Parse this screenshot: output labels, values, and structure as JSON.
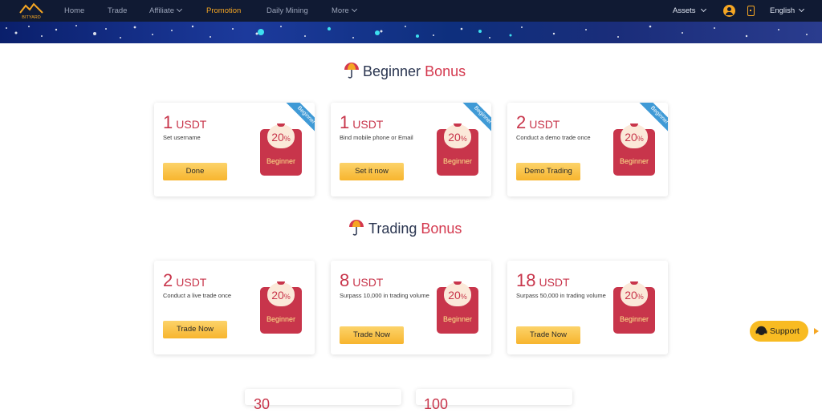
{
  "nav": {
    "logo_text": "BITYARD",
    "items": [
      {
        "label": "Home"
      },
      {
        "label": "Trade"
      },
      {
        "label": "Affiliate"
      },
      {
        "label": "Promotion"
      },
      {
        "label": "Daily Mining"
      },
      {
        "label": "More"
      }
    ],
    "assets_label": "Assets",
    "language_label": "English"
  },
  "sections": [
    {
      "title_main": "Beginner",
      "title_accent": "Bonus",
      "cards": [
        {
          "amount": "1",
          "unit": "USDT",
          "desc": "Set username",
          "button": "Done",
          "pct": "20",
          "pct_sign": "%",
          "env_label": "Beginner",
          "ribbon": "Beginner"
        },
        {
          "amount": "1",
          "unit": "USDT",
          "desc": "Bind mobile phone or Email",
          "button": "Set it now",
          "pct": "20",
          "pct_sign": "%",
          "env_label": "Beginner",
          "ribbon": "Beginner"
        },
        {
          "amount": "2",
          "unit": "USDT",
          "desc": "Conduct a demo trade once",
          "button": "Demo Trading",
          "pct": "20",
          "pct_sign": "%",
          "env_label": "Beginner",
          "ribbon": "Beginner"
        }
      ]
    },
    {
      "title_main": "Trading",
      "title_accent": "Bonus",
      "cards": [
        {
          "amount": "2",
          "unit": "USDT",
          "desc": "Conduct a live trade once",
          "button": "Trade Now",
          "pct": "20",
          "pct_sign": "%",
          "env_label": "Beginner"
        },
        {
          "amount": "8",
          "unit": "USDT",
          "desc": "Surpass 10,000 in trading volume",
          "button": "Trade Now",
          "pct": "20",
          "pct_sign": "%",
          "env_label": "Beginner"
        },
        {
          "amount": "18",
          "unit": "USDT",
          "desc": "Surpass 50,000 in trading volume",
          "button": "Trade Now",
          "pct": "20",
          "pct_sign": "%",
          "env_label": "Beginner"
        }
      ]
    }
  ],
  "support": {
    "label": "Support"
  },
  "partial_cards": [
    {
      "amount": "30"
    },
    {
      "amount": "100"
    }
  ],
  "colors": {
    "nav_bg": "#101a33",
    "accent": "#f5a623",
    "brand_red": "#c8354b",
    "button_yellow": "#f7b52e",
    "ribbon_blue": "#3f9ad6"
  }
}
